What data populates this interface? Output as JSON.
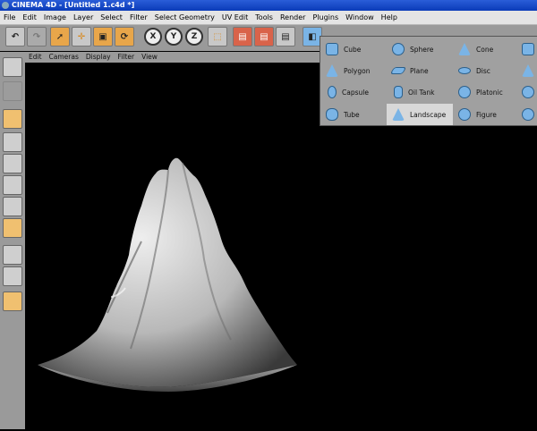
{
  "window": {
    "title": "CINEMA 4D - [Untitled 1.c4d *]"
  },
  "menu": [
    "File",
    "Edit",
    "Image",
    "Layer",
    "Select",
    "Filter",
    "Select Geometry",
    "UV Edit",
    "Tools",
    "Render",
    "Plugins",
    "Window",
    "Help"
  ],
  "toolbar": {
    "axis_x": "X",
    "axis_y": "Y",
    "axis_z": "Z"
  },
  "viewport_menu": [
    "Edit",
    "Cameras",
    "Display",
    "Filter",
    "View"
  ],
  "primitives_popup": {
    "items": [
      {
        "label": "Cube",
        "icon": "cube-icon"
      },
      {
        "label": "Sphere",
        "icon": "sphere-icon"
      },
      {
        "label": "Cone",
        "icon": "cone-icon"
      },
      {
        "label": "Polygon",
        "icon": "polygon-icon"
      },
      {
        "label": "Plane",
        "icon": "plane-icon"
      },
      {
        "label": "Disc",
        "icon": "disc-icon"
      },
      {
        "label": "Capsule",
        "icon": "capsule-icon"
      },
      {
        "label": "Oil Tank",
        "icon": "oil-tank-icon"
      },
      {
        "label": "Platonic",
        "icon": "platonic-icon"
      },
      {
        "label": "Tube",
        "icon": "tube-icon"
      },
      {
        "label": "Landscape",
        "icon": "landscape-icon",
        "selected": true
      },
      {
        "label": "Figure",
        "icon": "figure-icon"
      }
    ]
  },
  "colors": {
    "accent_blue": "#7ab4e6",
    "toolbar_gray": "#9a9a9a",
    "viewport_bg": "#000000"
  }
}
